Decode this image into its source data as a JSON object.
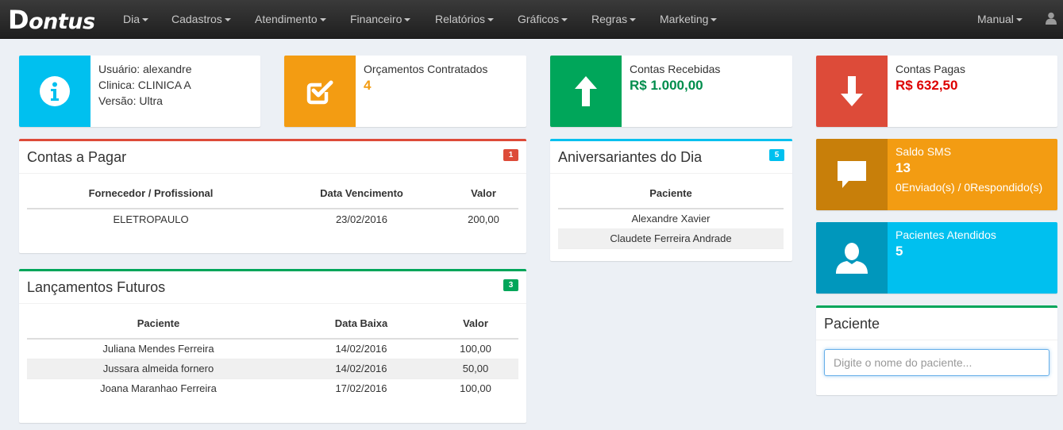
{
  "brand": "Dontus",
  "nav": [
    {
      "label": "Dia"
    },
    {
      "label": "Cadastros"
    },
    {
      "label": "Atendimento"
    },
    {
      "label": "Financeiro"
    },
    {
      "label": "Relatórios"
    },
    {
      "label": "Gráficos"
    },
    {
      "label": "Regras"
    },
    {
      "label": "Marketing"
    }
  ],
  "nav_right": {
    "manual": "Manual",
    "user_icon": "user-icon"
  },
  "info": {
    "user": {
      "line1": "Usuário: alexandre",
      "line2": "Clinica: CLINICA A",
      "line3": "Versão: Ultra",
      "icon": "info-icon",
      "color": "#00c0ef"
    },
    "orcamentos": {
      "label": "Orçamentos Contratados",
      "value": "4",
      "icon": "checkbox-icon",
      "color": "#f39c12"
    },
    "recebidas": {
      "label": "Contas Recebidas",
      "value": "R$ 1.000,00",
      "icon": "arrow-up-icon",
      "color": "#00a65a"
    },
    "pagas": {
      "label": "Contas Pagas",
      "value": "R$ 632,50",
      "icon": "arrow-down-icon",
      "color": "#dd4b39"
    },
    "sms": {
      "label": "Saldo SMS",
      "value": "13",
      "detail": "0Enviado(s) / 0Respondido(s)",
      "icon": "chat-icon",
      "color": "#f39c12"
    },
    "pacientes": {
      "label": "Pacientes Atendidos",
      "value": "5",
      "icon": "person-icon",
      "color": "#00c0ef"
    }
  },
  "contas_pagar": {
    "title": "Contas a Pagar",
    "badge": "1",
    "headers": [
      "Fornecedor / Profissional",
      "Data Vencimento",
      "Valor"
    ],
    "rows": [
      [
        "ELETROPAULO",
        "23/02/2016",
        "200,00"
      ]
    ]
  },
  "aniversariantes": {
    "title": "Aniversariantes do Dia",
    "badge": "5",
    "headers": [
      "Paciente"
    ],
    "rows": [
      [
        "Alexandre Xavier"
      ],
      [
        "Claudete Ferreira Andrade"
      ]
    ]
  },
  "lancamentos": {
    "title": "Lançamentos Futuros",
    "badge": "3",
    "headers": [
      "Paciente",
      "Data Baixa",
      "Valor"
    ],
    "rows": [
      [
        "Juliana Mendes Ferreira",
        "14/02/2016",
        "100,00"
      ],
      [
        "Jussara almeida fornero",
        "14/02/2016",
        "50,00"
      ],
      [
        "Joana Maranhao Ferreira",
        "17/02/2016",
        "100,00"
      ]
    ]
  },
  "paciente_search": {
    "title": "Paciente",
    "placeholder": "Digite o nome do paciente...",
    "value": ""
  },
  "colors": {
    "red": "#dd4b39",
    "green": "#00a65a",
    "cyan": "#00c0ef",
    "orange": "#f39c12"
  }
}
